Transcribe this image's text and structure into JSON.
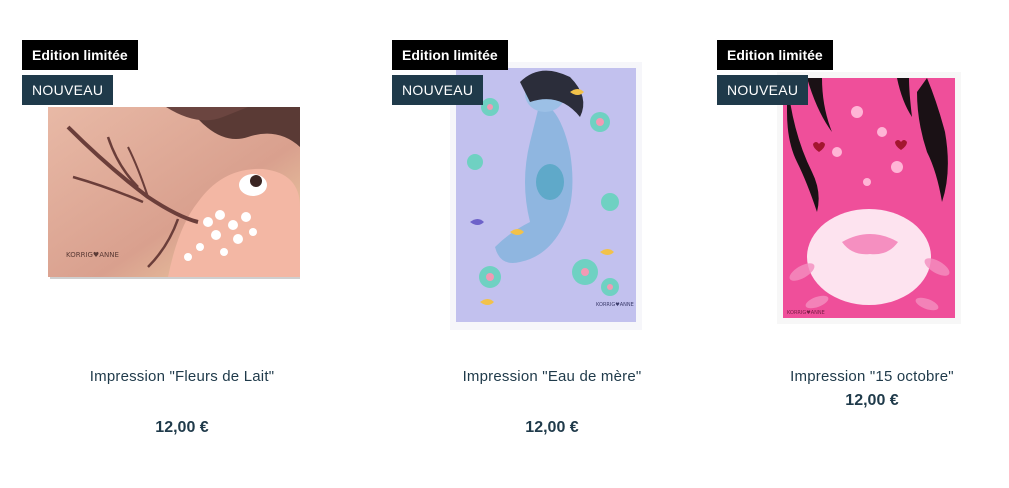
{
  "products": [
    {
      "badge_limited": "Edition limitée",
      "badge_new": "NOUVEAU",
      "title": "Impression \"Fleurs de Lait\"",
      "price": "12,00 €",
      "image_icon": "breastfeeding-cherry-blossom-illustration"
    },
    {
      "badge_limited": "Edition limitée",
      "badge_new": "NOUVEAU",
      "title": "Impression \"Eau de mère\"",
      "price": "12,00 €",
      "image_icon": "pregnant-woman-floating-water-illustration"
    },
    {
      "badge_limited": "Edition limitée",
      "badge_new": "NOUVEAU",
      "title": "Impression \"15 octobre\"",
      "price": "12,00 €",
      "image_icon": "pink-pregnancy-loss-illustration"
    }
  ],
  "colors": {
    "badge_limited_bg": "#000000",
    "badge_new_bg": "#1f3a4a",
    "text": "#1f3a4a"
  }
}
